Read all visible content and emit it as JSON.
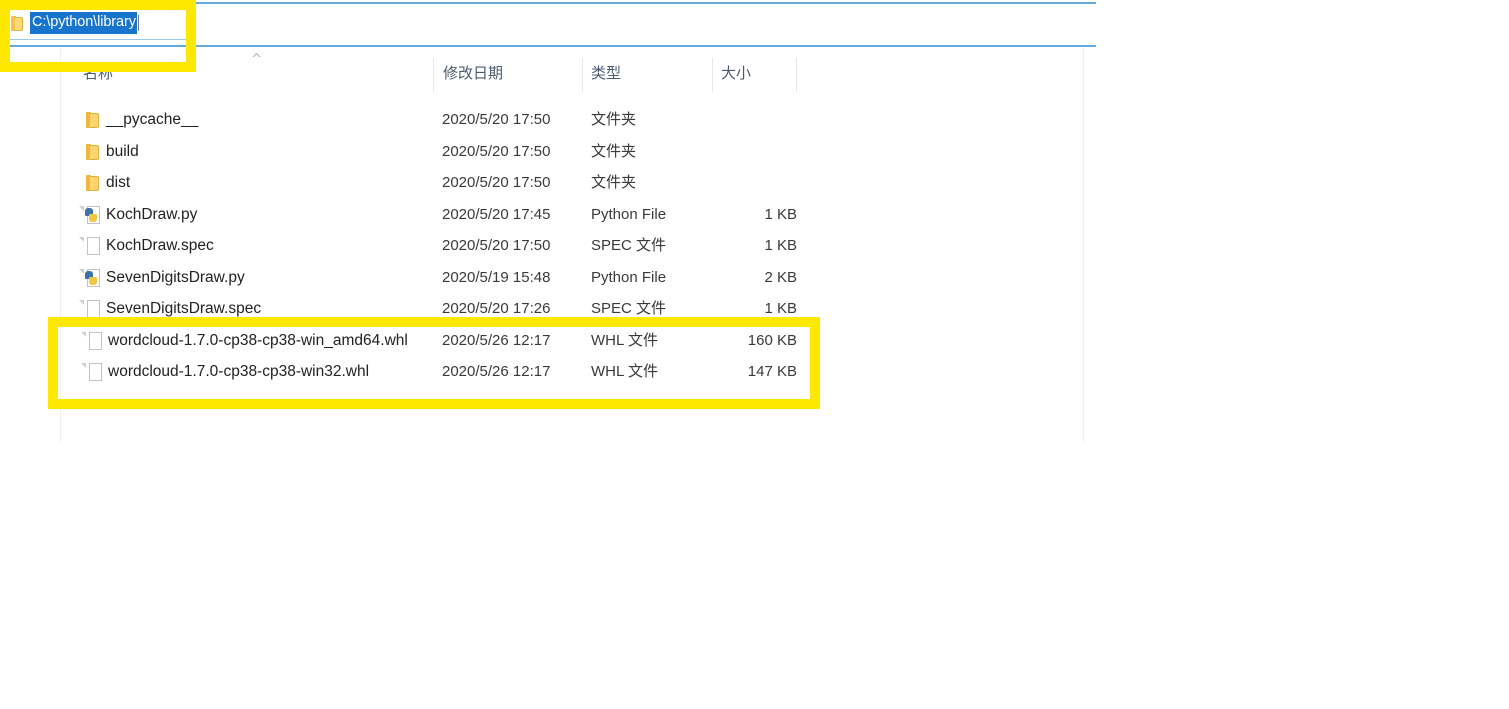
{
  "window": {
    "app": "Windows File Explorer",
    "accent_color": "#64a9e0",
    "selection_color": "#1874cd",
    "highlight_color": "#ffe800"
  },
  "address_bar": {
    "icon": "folder-icon",
    "path_value": "C:\\python\\library",
    "placeholder": "C:\\python\\library",
    "selected": true
  },
  "file_list": {
    "sort_indicator": "^",
    "columns": [
      {
        "key": "name",
        "label": "名称"
      },
      {
        "key": "date",
        "label": "修改日期"
      },
      {
        "key": "type",
        "label": "类型"
      },
      {
        "key": "size",
        "label": "大小"
      }
    ],
    "rows": [
      {
        "icon": "folder-icon",
        "name": "__pycache__",
        "date": "2020/5/20 17:50",
        "type": "文件夹",
        "size": "",
        "highlighted": false
      },
      {
        "icon": "folder-icon",
        "name": "build",
        "date": "2020/5/20 17:50",
        "type": "文件夹",
        "size": "",
        "highlighted": false
      },
      {
        "icon": "folder-icon",
        "name": "dist",
        "date": "2020/5/20 17:50",
        "type": "文件夹",
        "size": "",
        "highlighted": false
      },
      {
        "icon": "python-file-icon",
        "name": "KochDraw.py",
        "date": "2020/5/20 17:45",
        "type": "Python File",
        "size": "1 KB",
        "highlighted": false
      },
      {
        "icon": "document-file-icon",
        "name": "KochDraw.spec",
        "date": "2020/5/20 17:50",
        "type": "SPEC 文件",
        "size": "1 KB",
        "highlighted": false
      },
      {
        "icon": "python-file-icon",
        "name": "SevenDigitsDraw.py",
        "date": "2020/5/19 15:48",
        "type": "Python File",
        "size": "2 KB",
        "highlighted": false
      },
      {
        "icon": "document-file-icon",
        "name": "SevenDigitsDraw.spec",
        "date": "2020/5/20 17:26",
        "type": "SPEC 文件",
        "size": "1 KB",
        "highlighted": false
      },
      {
        "icon": "document-file-icon",
        "name": "wordcloud-1.7.0-cp38-cp38-win_amd64.whl",
        "date": "2020/5/26 12:17",
        "type": "WHL 文件",
        "size": "160 KB",
        "highlighted": true
      },
      {
        "icon": "document-file-icon",
        "name": "wordcloud-1.7.0-cp38-cp38-win32.whl",
        "date": "2020/5/26 12:17",
        "type": "WHL 文件",
        "size": "147 KB",
        "highlighted": true
      }
    ]
  },
  "annotations": [
    {
      "name": "address-bar-callout",
      "target": "address_bar"
    },
    {
      "name": "whl-files-callout",
      "target": "wheel_rows"
    }
  ]
}
